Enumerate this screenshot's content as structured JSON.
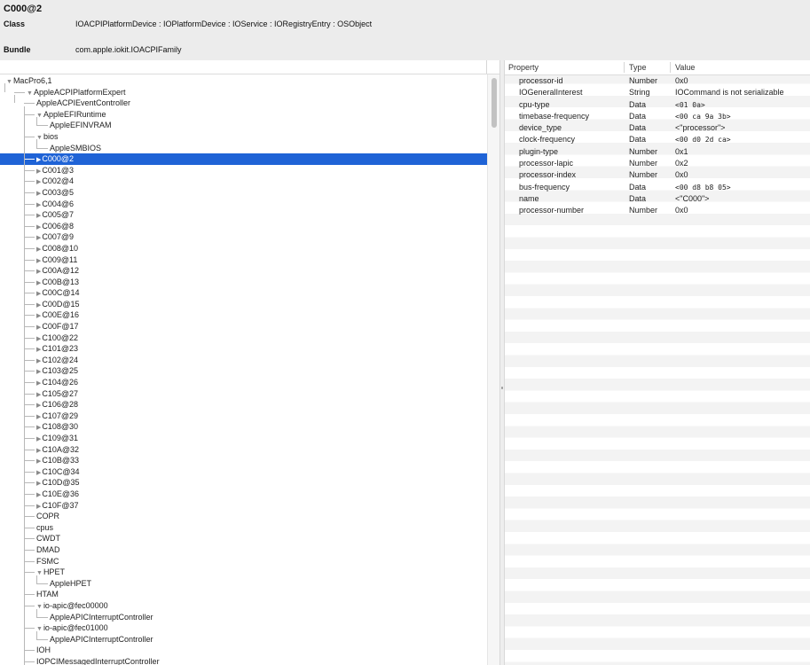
{
  "header": {
    "title": "C000@2",
    "class_label": "Class",
    "class_value": "IOACPIPlatformDevice : IOPlatformDevice : IOService : IORegistryEntry : OSObject",
    "bundle_label": "Bundle",
    "bundle_value": "com.apple.iokit.IOACPIFamily"
  },
  "tree": {
    "rows": [
      {
        "label": "MacPro6,1",
        "depth": 0,
        "arrow": "▼"
      },
      {
        "label": "AppleACPIPlatformExpert",
        "depth": 1,
        "arrow": "▼"
      },
      {
        "label": "AppleACPIEventController",
        "depth": 2,
        "arrow": ""
      },
      {
        "label": "AppleEFIRuntime",
        "depth": 2,
        "arrow": "▼"
      },
      {
        "label": "AppleEFINVRAM",
        "depth": 3,
        "arrow": ""
      },
      {
        "label": "bios",
        "depth": 2,
        "arrow": "▼"
      },
      {
        "label": "AppleSMBIOS",
        "depth": 3,
        "arrow": ""
      },
      {
        "label": "C000@2",
        "depth": 2,
        "arrow": "▶",
        "selected": true
      },
      {
        "label": "C001@3",
        "depth": 2,
        "arrow": "▶"
      },
      {
        "label": "C002@4",
        "depth": 2,
        "arrow": "▶"
      },
      {
        "label": "C003@5",
        "depth": 2,
        "arrow": "▶"
      },
      {
        "label": "C004@6",
        "depth": 2,
        "arrow": "▶"
      },
      {
        "label": "C005@7",
        "depth": 2,
        "arrow": "▶"
      },
      {
        "label": "C006@8",
        "depth": 2,
        "arrow": "▶"
      },
      {
        "label": "C007@9",
        "depth": 2,
        "arrow": "▶"
      },
      {
        "label": "C008@10",
        "depth": 2,
        "arrow": "▶"
      },
      {
        "label": "C009@11",
        "depth": 2,
        "arrow": "▶"
      },
      {
        "label": "C00A@12",
        "depth": 2,
        "arrow": "▶"
      },
      {
        "label": "C00B@13",
        "depth": 2,
        "arrow": "▶"
      },
      {
        "label": "C00C@14",
        "depth": 2,
        "arrow": "▶"
      },
      {
        "label": "C00D@15",
        "depth": 2,
        "arrow": "▶"
      },
      {
        "label": "C00E@16",
        "depth": 2,
        "arrow": "▶"
      },
      {
        "label": "C00F@17",
        "depth": 2,
        "arrow": "▶"
      },
      {
        "label": "C100@22",
        "depth": 2,
        "arrow": "▶"
      },
      {
        "label": "C101@23",
        "depth": 2,
        "arrow": "▶"
      },
      {
        "label": "C102@24",
        "depth": 2,
        "arrow": "▶"
      },
      {
        "label": "C103@25",
        "depth": 2,
        "arrow": "▶"
      },
      {
        "label": "C104@26",
        "depth": 2,
        "arrow": "▶"
      },
      {
        "label": "C105@27",
        "depth": 2,
        "arrow": "▶"
      },
      {
        "label": "C106@28",
        "depth": 2,
        "arrow": "▶"
      },
      {
        "label": "C107@29",
        "depth": 2,
        "arrow": "▶"
      },
      {
        "label": "C108@30",
        "depth": 2,
        "arrow": "▶"
      },
      {
        "label": "C109@31",
        "depth": 2,
        "arrow": "▶"
      },
      {
        "label": "C10A@32",
        "depth": 2,
        "arrow": "▶"
      },
      {
        "label": "C10B@33",
        "depth": 2,
        "arrow": "▶"
      },
      {
        "label": "C10C@34",
        "depth": 2,
        "arrow": "▶"
      },
      {
        "label": "C10D@35",
        "depth": 2,
        "arrow": "▶"
      },
      {
        "label": "C10E@36",
        "depth": 2,
        "arrow": "▶"
      },
      {
        "label": "C10F@37",
        "depth": 2,
        "arrow": "▶"
      },
      {
        "label": "COPR",
        "depth": 2,
        "arrow": ""
      },
      {
        "label": "cpus",
        "depth": 2,
        "arrow": ""
      },
      {
        "label": "CWDT",
        "depth": 2,
        "arrow": ""
      },
      {
        "label": "DMAD",
        "depth": 2,
        "arrow": ""
      },
      {
        "label": "FSMC",
        "depth": 2,
        "arrow": ""
      },
      {
        "label": "HPET",
        "depth": 2,
        "arrow": "▼"
      },
      {
        "label": "AppleHPET",
        "depth": 3,
        "arrow": ""
      },
      {
        "label": "HTAM",
        "depth": 2,
        "arrow": ""
      },
      {
        "label": "io-apic@fec00000",
        "depth": 2,
        "arrow": "▼"
      },
      {
        "label": "AppleAPICInterruptController",
        "depth": 3,
        "arrow": ""
      },
      {
        "label": "io-apic@fec01000",
        "depth": 2,
        "arrow": "▼"
      },
      {
        "label": "AppleAPICInterruptController",
        "depth": 3,
        "arrow": ""
      },
      {
        "label": "IOH",
        "depth": 2,
        "arrow": ""
      },
      {
        "label": "IOPCIMessagedInterruptController",
        "depth": 2,
        "arrow": ""
      }
    ]
  },
  "properties": {
    "columns": {
      "property": "Property",
      "type": "Type",
      "value": "Value"
    },
    "rows": [
      {
        "name": "processor-id",
        "type": "Number",
        "value": "0x0",
        "mono": false
      },
      {
        "name": "IOGeneralInterest",
        "type": "String",
        "value": "IOCommand is not serializable",
        "mono": false
      },
      {
        "name": "cpu-type",
        "type": "Data",
        "value": "<01 0a>",
        "mono": true
      },
      {
        "name": "timebase-frequency",
        "type": "Data",
        "value": "<00 ca 9a 3b>",
        "mono": true
      },
      {
        "name": "device_type",
        "type": "Data",
        "value": "<\"processor\">",
        "mono": false
      },
      {
        "name": "clock-frequency",
        "type": "Data",
        "value": "<00 d0 2d ca>",
        "mono": true
      },
      {
        "name": "plugin-type",
        "type": "Number",
        "value": "0x1",
        "mono": false
      },
      {
        "name": "processor-lapic",
        "type": "Number",
        "value": "0x2",
        "mono": false
      },
      {
        "name": "processor-index",
        "type": "Number",
        "value": "0x0",
        "mono": false
      },
      {
        "name": "bus-frequency",
        "type": "Data",
        "value": "<00 d8 b8 05>",
        "mono": true
      },
      {
        "name": "name",
        "type": "Data",
        "value": "<\"C000\">",
        "mono": false
      },
      {
        "name": "processor-number",
        "type": "Number",
        "value": "0x0",
        "mono": false
      }
    ]
  }
}
